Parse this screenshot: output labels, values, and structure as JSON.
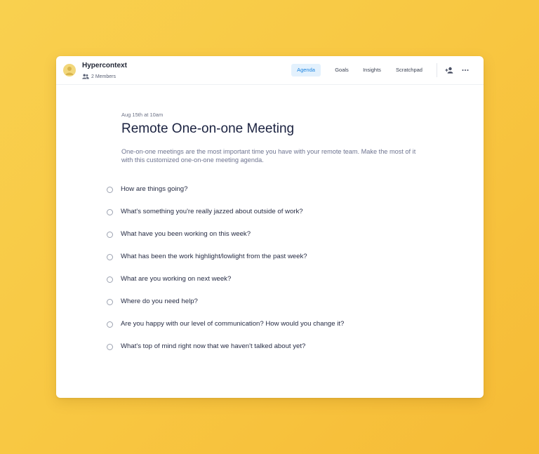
{
  "workspace": {
    "name": "Hypercontext",
    "members_label": "2 Members",
    "avatar_icon": "user-avatar-icon",
    "members_icon": "people-icon"
  },
  "tabs": [
    {
      "label": "Agenda",
      "active": true
    },
    {
      "label": "Goals",
      "active": false
    },
    {
      "label": "Insights",
      "active": false
    },
    {
      "label": "Scratchpad",
      "active": false
    }
  ],
  "header_actions": {
    "add_user_icon": "add-user-icon",
    "more_icon": "more-options-icon"
  },
  "meeting": {
    "date": "Aug 15th at 10am",
    "title": "Remote One-on-one Meeting",
    "description": "One-on-one meetings are the most important time you have with your remote team. Make the most of it with this customized one-on-one meeting agenda."
  },
  "agenda_items": [
    {
      "text": "How are things going?",
      "checked": false
    },
    {
      "text": "What's something you're really jazzed about outside of work?",
      "checked": false
    },
    {
      "text": "What have you been working on this week?",
      "checked": false
    },
    {
      "text": "What has been the work highlight/lowlight from the past week?",
      "checked": false
    },
    {
      "text": "What are you working on next week?",
      "checked": false
    },
    {
      "text": "Where do you need help?",
      "checked": false
    },
    {
      "text": "Are you happy with our level of communication? How would you change it?",
      "checked": false
    },
    {
      "text": "What's top of mind right now that we haven't talked about yet?",
      "checked": false
    }
  ],
  "colors": {
    "background": "#f8c843",
    "accent": "#1b84e0",
    "accent_bg": "#e3f1fd",
    "title": "#1b2240"
  }
}
